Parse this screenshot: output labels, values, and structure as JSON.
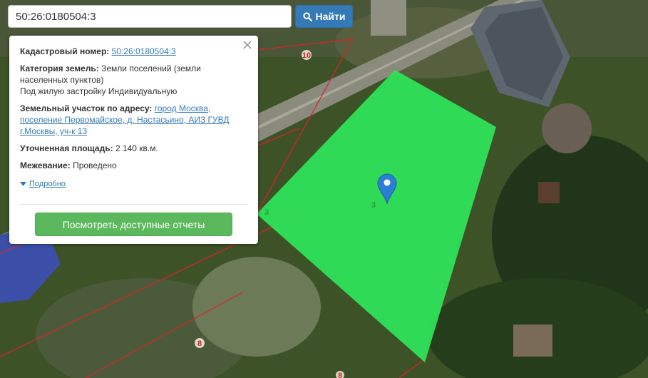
{
  "search": {
    "value": "50:26:0180504:3",
    "button_label": "Найти",
    "button_icon": "search-icon"
  },
  "info": {
    "cadastral_label": "Кадастровый номер:",
    "cadastral_value": "50:26:0180504:3",
    "category_label": "Категория земель:",
    "category_line1": "Земли поселений (земли",
    "category_line2": "населенных пунктов)",
    "category_line3": "Под жилую застройку Индивидуальную",
    "address_label": "Земельный участок по адресу:",
    "address_line1": "город Москва,",
    "address_line2": "поселение Первомайское, д. Настасьино, АИЗ ГУВД",
    "address_line3": "г.Москвы, уч-к 13",
    "area_label": "Уточненная площадь:",
    "area_value": "2 140 кв.м.",
    "survey_label": "Межевание:",
    "survey_value": "Проведено",
    "more_label": "Подробно",
    "reports_button": "Посмотреть доступные отчеты",
    "close_icon": "close-icon"
  },
  "map": {
    "labels": [
      "10",
      "3",
      "3",
      "8",
      "8"
    ],
    "parcel_color": "#2ee65a",
    "boundary_color": "#e0202a",
    "marker_color": "#2a7fd4",
    "marker_icon": "map-pin-icon"
  }
}
